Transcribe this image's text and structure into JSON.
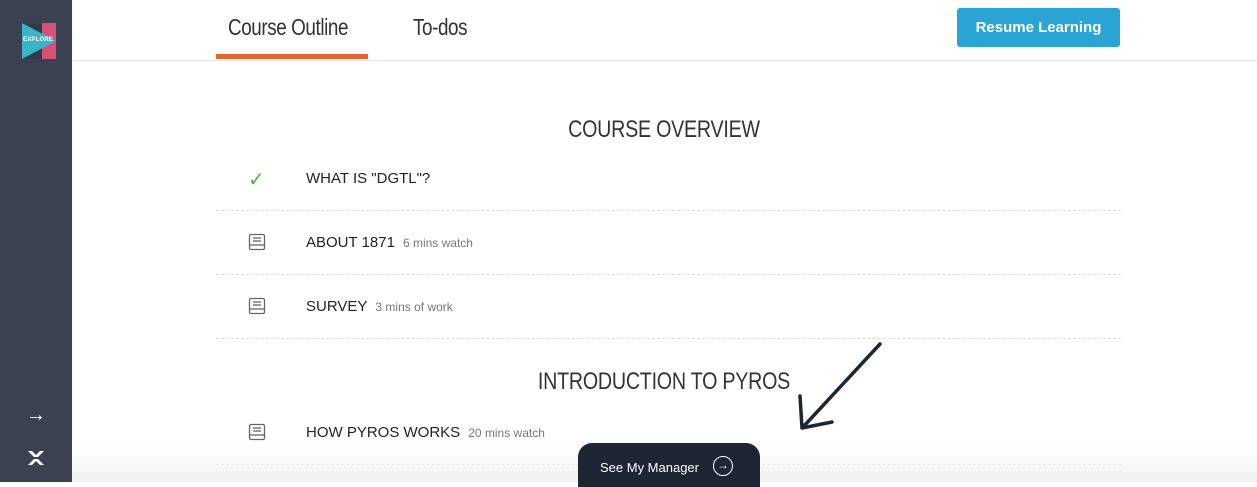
{
  "sidebar": {
    "logo_text": "EXPLORE",
    "collapse_icon": "arrow-right-icon",
    "brand_icon": "brand-mark-icon"
  },
  "tabs": [
    {
      "label": "Course Outline",
      "active": true
    },
    {
      "label": "To-dos",
      "active": false
    }
  ],
  "resume_button": "Resume Learning",
  "sections": [
    {
      "title": "COURSE OVERVIEW",
      "items": [
        {
          "label": "WHAT IS \"DGTL\"?",
          "duration": "",
          "status": "complete",
          "icon": "check-icon"
        },
        {
          "label": "ABOUT 1871",
          "duration": "6 mins watch",
          "status": "incomplete",
          "icon": "document-icon"
        },
        {
          "label": "SURVEY",
          "duration": "3 mins of work",
          "status": "incomplete",
          "icon": "document-icon"
        }
      ]
    },
    {
      "title": "INTRODUCTION TO PYROS",
      "items": [
        {
          "label": "HOW PYROS WORKS",
          "duration": "20 mins watch",
          "status": "incomplete",
          "icon": "document-icon"
        }
      ]
    }
  ],
  "manager_button": "See My Manager",
  "colors": {
    "sidebar": "#3b4150",
    "accent": "#e8622c",
    "button": "#2aa4d4",
    "check": "#4caf50"
  }
}
